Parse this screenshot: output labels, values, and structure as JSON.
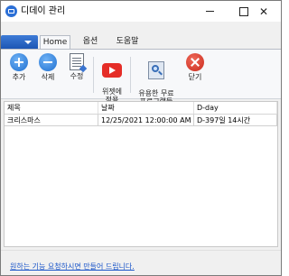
{
  "window": {
    "title": "디데이 관리",
    "close_glyph": "✕"
  },
  "ribbon": {
    "tabs": [
      {
        "label": "Home",
        "active": true
      },
      {
        "label": "옵션",
        "active": false
      },
      {
        "label": "도움말",
        "active": false
      }
    ],
    "buttons": [
      {
        "label": "추가",
        "icon": "add-icon"
      },
      {
        "label": "삭제",
        "icon": "remove-icon"
      },
      {
        "label": "수정",
        "icon": "edit-document-icon"
      },
      {
        "label": "위젯에\n적용",
        "icon": "youtube-play-icon"
      },
      {
        "label": "유용한 무료\n프로그램들",
        "icon": "magnifier-icon"
      },
      {
        "label": "닫기",
        "icon": "close-circle-icon"
      }
    ]
  },
  "grid": {
    "columns": [
      "제목",
      "날짜",
      "D-day"
    ],
    "rows": [
      [
        "크리스마스",
        "12/25/2021 12:00:00 AM",
        "D-397일 14시간"
      ]
    ]
  },
  "status": {
    "link_text": "원하는 기능 요청하시면 만들어 드립니다."
  },
  "colors": {
    "accent": "#1d56b4",
    "link": "#1a55c9"
  }
}
